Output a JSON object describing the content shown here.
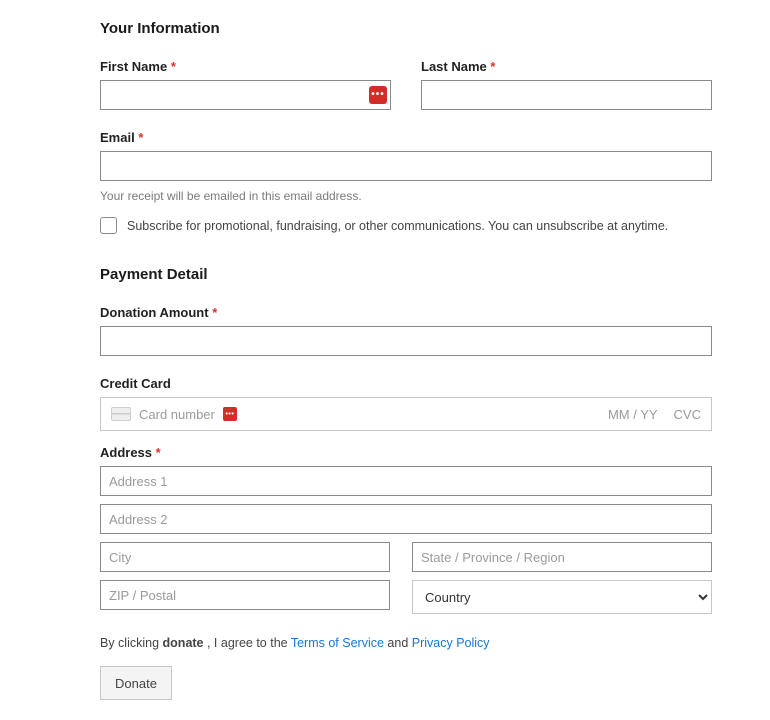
{
  "info": {
    "title": "Your Information",
    "first_name_label": "First Name",
    "last_name_label": "Last Name",
    "email_label": "Email",
    "email_helper": "Your receipt will be emailed in this email address.",
    "subscribe_label": "Subscribe for promotional, fundraising, or other communications. You can unsubscribe at anytime.",
    "req": "*"
  },
  "payment": {
    "title": "Payment Detail",
    "donation_label": "Donation Amount",
    "card_label": "Credit Card",
    "card_number_placeholder": "Card number",
    "card_exp_placeholder": "MM / YY",
    "card_cvc_placeholder": "CVC",
    "address_label": "Address",
    "address1_placeholder": "Address 1",
    "address2_placeholder": "Address 2",
    "city_placeholder": "City",
    "state_placeholder": "State / Province / Region",
    "zip_placeholder": "ZIP / Postal",
    "country_placeholder": "Country"
  },
  "agree": {
    "pre": "By clicking ",
    "bold": "donate",
    "mid": " , I agree to the ",
    "tos": "Terms of Service",
    "and": " and ",
    "privacy": "Privacy Policy"
  },
  "donate_btn": "Donate",
  "lastpass_glyph": "•••"
}
